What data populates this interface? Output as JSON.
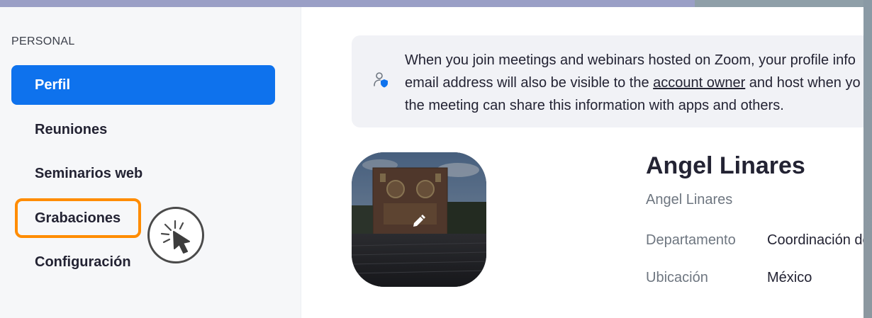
{
  "sidebar": {
    "section_label": "PERSONAL",
    "items": [
      {
        "label": "Perfil",
        "active": true
      },
      {
        "label": "Reuniones",
        "active": false
      },
      {
        "label": "Seminarios web",
        "active": false
      },
      {
        "label": "Grabaciones",
        "active": false,
        "highlighted": true
      },
      {
        "label": "Configuración",
        "active": false
      }
    ]
  },
  "banner": {
    "icon": "profile-shield-icon",
    "line1": "When you join meetings and webinars hosted on Zoom, your profile info",
    "line2_before": "email address will also be visible to the ",
    "line2_link": "account owner",
    "line2_after": " and host when yo",
    "line3": "the meeting can share this information with apps and others."
  },
  "profile": {
    "name": "Angel Linares",
    "display_name": "Angel Linares",
    "fields": [
      {
        "label": "Departamento",
        "value": "Coordinación de"
      },
      {
        "label": "Ubicación",
        "value": "México"
      }
    ]
  },
  "colors": {
    "accent": "#0e72ed",
    "highlight": "#ff8c00",
    "text": "#232333",
    "muted": "#6e7680"
  }
}
